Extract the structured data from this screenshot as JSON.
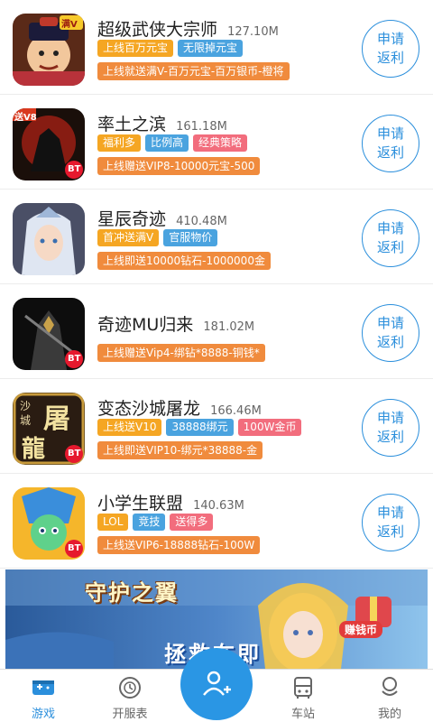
{
  "games": [
    {
      "name": "超级武侠大宗师",
      "size": "127.10M",
      "tags": [
        {
          "text": "上线百万元宝",
          "color": "#f5a623"
        },
        {
          "text": "无限掉元宝",
          "color": "#4aa3df"
        }
      ],
      "promo": "上线就送满V-百万元宝-百万银币-橙将",
      "apply": [
        "申请",
        "返利"
      ],
      "badge": "满V"
    },
    {
      "name": "率土之滨",
      "size": "161.18M",
      "tags": [
        {
          "text": "福利多",
          "color": "#f5a623"
        },
        {
          "text": "比例高",
          "color": "#4aa3df"
        },
        {
          "text": "经典策略",
          "color": "#f26d7d"
        }
      ],
      "promo": "上线赠送VIP8-10000元宝-500",
      "apply": [
        "申请",
        "返利"
      ],
      "badge": "送V8"
    },
    {
      "name": "星辰奇迹",
      "size": "410.48M",
      "tags": [
        {
          "text": "首冲送满V",
          "color": "#f5a623"
        },
        {
          "text": "官服物价",
          "color": "#4aa3df"
        }
      ],
      "promo": "上线即送10000钻石-1000000金",
      "apply": [
        "申请",
        "返利"
      ]
    },
    {
      "name": "奇迹MU归来",
      "size": "181.02M",
      "tags": [],
      "promo": "上线赠送Vip4-绑钻*8888-铜钱*",
      "apply": [
        "申请",
        "返利"
      ]
    },
    {
      "name": "变态沙城屠龙",
      "size": "166.46M",
      "tags": [
        {
          "text": "上线送V10",
          "color": "#f5a623"
        },
        {
          "text": "38888绑元",
          "color": "#4aa3df"
        },
        {
          "text": "100W金币",
          "color": "#f26d7d"
        }
      ],
      "promo": "上线即送VIP10-绑元*38888-金",
      "apply": [
        "申请",
        "返利"
      ],
      "art_text": [
        "沙",
        "城",
        "屠",
        "龍"
      ]
    },
    {
      "name": "小学生联盟",
      "size": "140.63M",
      "tags": [
        {
          "text": "LOL",
          "color": "#f5a623"
        },
        {
          "text": "竞技",
          "color": "#4aa3df"
        },
        {
          "text": "送得多",
          "color": "#f26d7d"
        }
      ],
      "promo": "上线送VIP6-18888钻石-100W",
      "apply": [
        "申请",
        "返利"
      ]
    }
  ],
  "bt_label": "BT",
  "banner": {
    "title": "守护之翼",
    "subtitle": "拯救在即",
    "badge": "赚钱币"
  },
  "nav": {
    "items": [
      {
        "label": "游戏",
        "icon": "gamepad-icon",
        "active": true
      },
      {
        "label": "开服表",
        "icon": "clock-icon",
        "active": false
      },
      {
        "label": "",
        "icon": "add-friend-icon",
        "active": false
      },
      {
        "label": "车站",
        "icon": "bus-icon",
        "active": false
      },
      {
        "label": "我的",
        "icon": "user-icon",
        "active": false
      }
    ]
  },
  "colors": {
    "accent": "#2b8fdc",
    "promo": "#f08b3d",
    "center_button": "#2a96e4"
  }
}
